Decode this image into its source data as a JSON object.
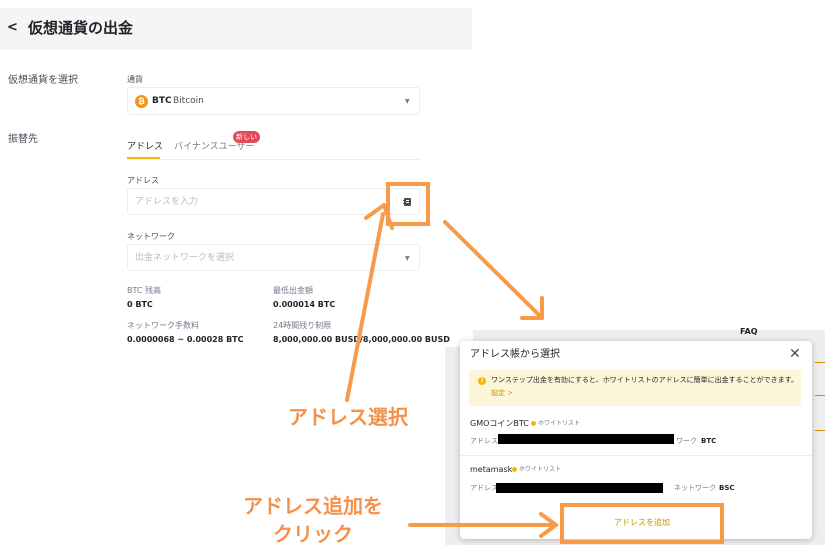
{
  "header": {
    "back_icon": "chevron-left-icon",
    "title": "仮想通貨の出金"
  },
  "form": {
    "select_crypto_label": "仮想通貨を選択",
    "currency_label": "通貨",
    "currency": {
      "icon_letter": "₿",
      "symbol": "BTC",
      "name": "Bitcoin"
    },
    "transfer_to_label": "振替先",
    "tabs": [
      {
        "label": "アドレス",
        "active": true
      },
      {
        "label": "バイナンスユーザー",
        "active": false
      }
    ],
    "new_badge": "新しい",
    "address_label": "アドレス",
    "address_placeholder": "アドレスを入力",
    "network_label": "ネットワーク",
    "network_placeholder": "出金ネットワークを選択",
    "stats": {
      "balance_label": "BTC 残高",
      "balance_value": "0 BTC",
      "min_label": "最低出金額",
      "min_value": "0.000014 BTC",
      "fee_label": "ネットワーク手数料",
      "fee_value": "0.0000068 ~ 0.00028 BTC",
      "limit_label": "24時間残り制限",
      "limit_value": "8,000,000.00 BUSD/8,000,000.00 BUSD"
    }
  },
  "annotations": {
    "select_address": "アドレス選択",
    "add_address_line1": "アドレス追加を",
    "add_address_line2": "クリック",
    "color": "#f79a4a"
  },
  "background": {
    "faq": "FAQ"
  },
  "modal": {
    "title": "アドレス帳から選択",
    "close_icon": "close-icon",
    "notice": "ワンステップ出金を有効にすると、ホワイトリストのアドレスに簡単に出金することができます。",
    "notice_link": "設定 >",
    "entries": [
      {
        "name": "GMOコインBTC",
        "whitelist": "ホワイトリスト",
        "address_label": "アドレス",
        "network_label": "ワーク",
        "network": "BTC"
      },
      {
        "name": "metamask",
        "whitelist": "ホワイトリスト",
        "address_label": "アドレス",
        "network_label": "ネットワーク",
        "network": "BSC"
      }
    ],
    "add_button": "アドレスを追加"
  }
}
